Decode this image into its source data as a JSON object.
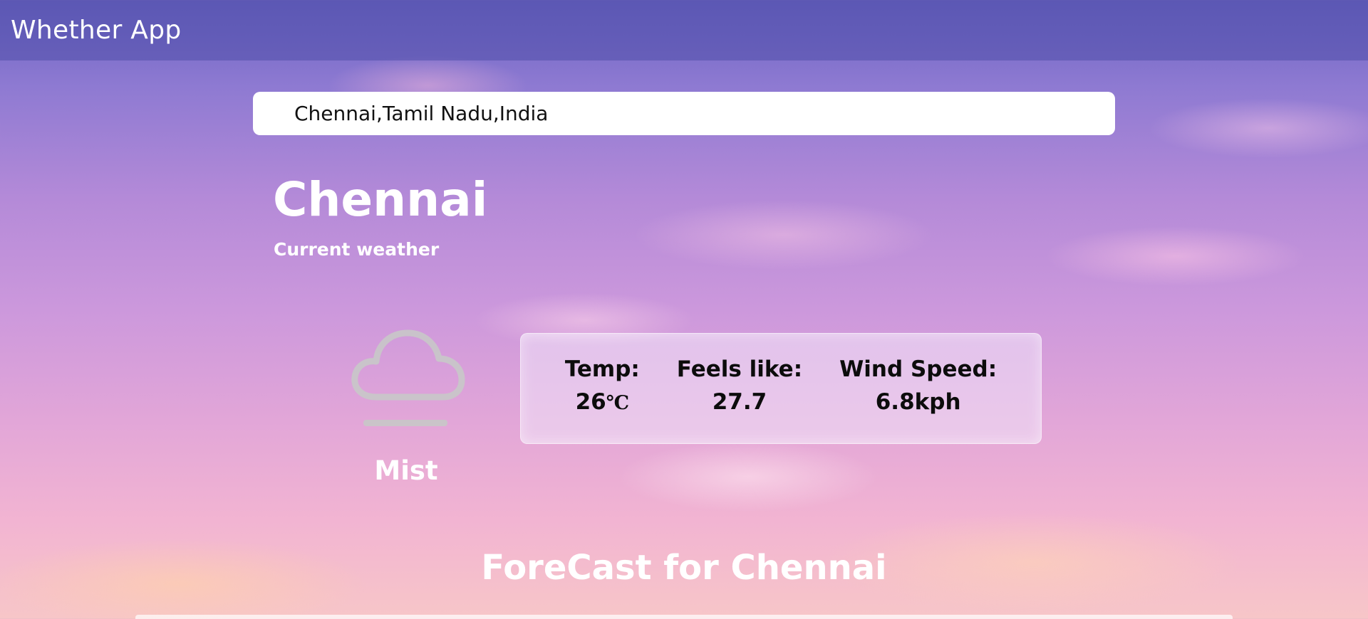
{
  "app": {
    "title": "Whether App"
  },
  "search": {
    "value": "Chennai,Tamil Nadu,India"
  },
  "current": {
    "city": "Chennai",
    "subtitle": "Current weather",
    "condition": "Mist",
    "condition_icon": "cloud-mist-icon",
    "stats": [
      {
        "label": "Temp:",
        "value": "26",
        "unit": "℃"
      },
      {
        "label": "Feels like:",
        "value": "27.7",
        "unit": ""
      },
      {
        "label": "Wind Speed:",
        "value": "6.8kph",
        "unit": ""
      }
    ]
  },
  "forecast": {
    "title": "ForeCast for Chennai"
  },
  "colors": {
    "header_bg": "#504eaa",
    "text_light": "#ffffff",
    "text_dark": "#0c0c0c",
    "icon_gray": "#c8c8c8"
  }
}
